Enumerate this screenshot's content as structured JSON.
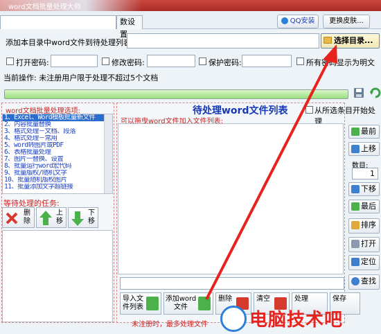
{
  "window": {
    "title": "word文档批量处理大师"
  },
  "tabs": [
    {
      "label": ""
    },
    {
      "label": "数设置"
    }
  ],
  "top_buttons": {
    "qq": "QQ安装",
    "skin": "更换皮肤..."
  },
  "path_row": {
    "label": "添加本目录中word文件到待处理列表:",
    "value": "",
    "select_dir": "选择目录..."
  },
  "password_row": {
    "open_label": "打开密码:",
    "modify_label": "修改密码:",
    "protect_label": "保护密码:",
    "show_plain_label": "所有密码显示为明文"
  },
  "status": {
    "text": "当前操作: 未注册用户限于处理不超过5个文档"
  },
  "left_panel": {
    "title": "word文档批量处理选项:",
    "options": [
      "1、Excel、Word模板批量新文件",
      "2、内容批量替换",
      "3、格式处理－文档、段落",
      "4、格式处理－常用",
      "5、word转图片或PDF",
      "6、表格批量处理",
      "7、图片一替换、设置",
      "8、批量运行word宏代码",
      "9、批量版权/随机文字",
      "10、批量随机版权图片",
      "11、批量添加文字超链接"
    ],
    "wait_title": "等待处理的任务:",
    "delete_label": "删除",
    "up_label": "上移",
    "down_label": "下移"
  },
  "center_panel": {
    "title": "待处理word文件列表",
    "from_selected": "从所选条目开始处理",
    "drag_hint": "可以拖曳word文件加入文件列表:",
    "import_label": "导入文件列表",
    "add_label": "添加word文件",
    "delete_label": "删除",
    "clear_label": "清空",
    "process_label": "处理",
    "save_label": "保存",
    "note": "未注册时，最多处理文件"
  },
  "right_column": {
    "top": "最前",
    "up": "上移",
    "count_label": "数目:",
    "count_value": "1",
    "down": "下移",
    "bottom": "最后",
    "sort": "排序",
    "open": "打开",
    "locate": "定位",
    "find": "查找"
  },
  "watermark": {
    "text": "电脑技术吧"
  },
  "colors": {
    "accent_red": "#e8231d",
    "title_blue": "#1538b8",
    "list_blue": "#1a3fc4",
    "selected_row": "#2b6ccf"
  }
}
